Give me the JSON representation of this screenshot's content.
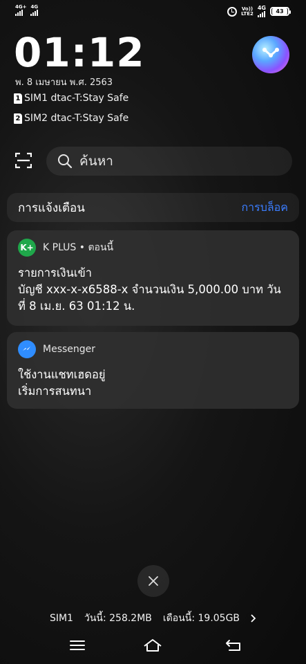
{
  "status_bar": {
    "sim1_network": "4G+",
    "sim2_network": "4G",
    "volte_top": "Vo))",
    "volte_bottom": "LTE2",
    "data_network": "4G",
    "battery": "43"
  },
  "clock": {
    "time": "01:12",
    "date": "พ. 8 เมษายน พ.ศ. 2563"
  },
  "sims": [
    {
      "slot": "1",
      "label": "SIM1 dtac-T:Stay Safe"
    },
    {
      "slot": "2",
      "label": "SIM2 dtac-T:Stay Safe"
    }
  ],
  "search": {
    "placeholder": "ค้นหา"
  },
  "notifications": {
    "title": "การแจ้งเตือน",
    "block_label": "การบล็อค",
    "items": [
      {
        "app_icon": "kplus-icon",
        "app_icon_text": "K+",
        "icon_color": "#1fa74a",
        "app": "K PLUS • ตอนนี้",
        "title": "รายการเงินเข้า",
        "body": "บัญชี xxx-x-x6588-x  จำนวนเงิน 5,000.00 บาท  วันที่ 8 เม.ย. 63  01:12 น."
      },
      {
        "app_icon": "messenger-icon",
        "icon_color": "#2f8dff",
        "app": "Messenger",
        "title": "ใช้งานแชทเฮดอยู่",
        "body": "เริ่มการสนทนา"
      }
    ]
  },
  "data_usage": {
    "sim": "SIM1",
    "today": "วันนี้: 258.2MB",
    "month": "เดือนนี้: 19.05GB"
  },
  "colors": {
    "accent": "#3b7dff",
    "kplus": "#1fa74a",
    "messenger": "#2f8dff"
  }
}
